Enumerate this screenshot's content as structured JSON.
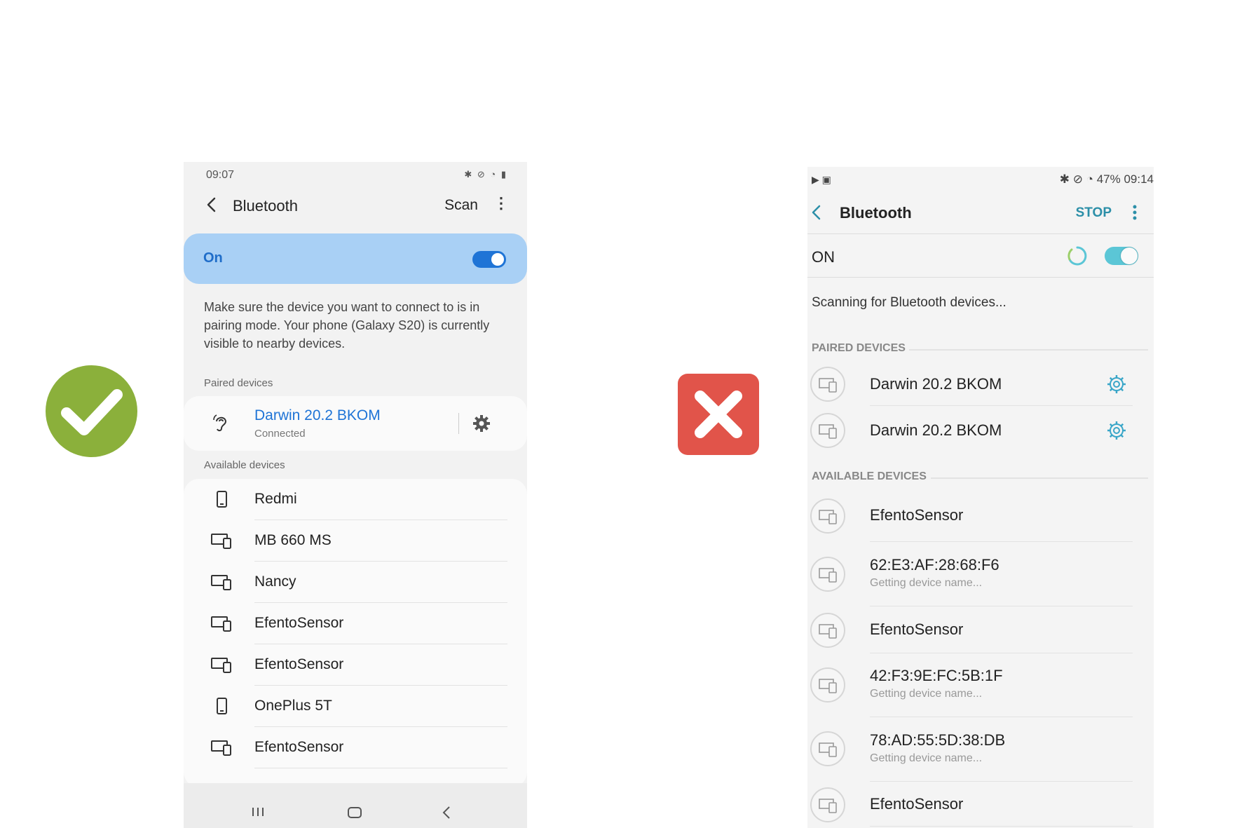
{
  "colors": {
    "correct": "#8bb03b",
    "incorrect": "#e1544a",
    "accent_left": "#1f74d6",
    "accent_right": "#2c8fa8"
  },
  "badges": {
    "left_icon": "checkmark-icon",
    "right_icon": "x-mark-icon"
  },
  "left_phone": {
    "status_time": "09:07",
    "title": "Bluetooth",
    "scan_label": "Scan",
    "on_label": "On",
    "toggle_on": true,
    "description": "Make sure the device you want to connect to is in pairing mode. Your phone (Galaxy S20) is currently visible to nearby devices.",
    "paired_header": "Paired devices",
    "paired": {
      "name": "Darwin 20.2 BKOM",
      "status": "Connected",
      "icon": "hearing-icon"
    },
    "available_header": "Available devices",
    "available": [
      {
        "name": "Redmi",
        "icon": "phone-icon"
      },
      {
        "name": "MB 660 MS",
        "icon": "devices-icon"
      },
      {
        "name": "Nancy",
        "icon": "devices-icon"
      },
      {
        "name": "EfentoSensor",
        "icon": "devices-icon"
      },
      {
        "name": "EfentoSensor",
        "icon": "devices-icon"
      },
      {
        "name": "OnePlus 5T",
        "icon": "phone-icon"
      },
      {
        "name": "EfentoSensor",
        "icon": "devices-icon"
      }
    ]
  },
  "right_phone": {
    "status_right": "47% 09:14",
    "title": "Bluetooth",
    "stop_label": "STOP",
    "on_label": "ON",
    "toggle_on": true,
    "scanning_text": "Scanning for Bluetooth devices...",
    "paired_header": "PAIRED DEVICES",
    "paired": [
      {
        "name": "Darwin 20.2 BKOM"
      },
      {
        "name": "Darwin 20.2 BKOM"
      }
    ],
    "available_header": "AVAILABLE DEVICES",
    "available": [
      {
        "name": "EfentoSensor",
        "sub": ""
      },
      {
        "name": "62:E3:AF:28:68:F6",
        "sub": "Getting device name..."
      },
      {
        "name": "EfentoSensor",
        "sub": ""
      },
      {
        "name": "42:F3:9E:FC:5B:1F",
        "sub": "Getting device name..."
      },
      {
        "name": "78:AD:55:5D:38:DB",
        "sub": "Getting device name..."
      },
      {
        "name": "EfentoSensor",
        "sub": ""
      }
    ]
  }
}
